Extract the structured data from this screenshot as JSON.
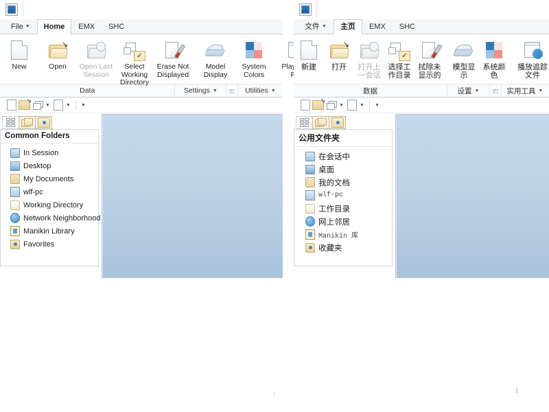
{
  "slide": {
    "page_number": "1"
  },
  "en": {
    "app_icon": "application-icon",
    "tabs": [
      {
        "label": "File",
        "has_caret": true,
        "active": false
      },
      {
        "label": "Home",
        "has_caret": false,
        "active": true
      },
      {
        "label": "EMX",
        "has_caret": false,
        "active": false
      },
      {
        "label": "SHC",
        "has_caret": false,
        "active": false
      }
    ],
    "ribbon": {
      "groups": [
        {
          "caption": "Data",
          "caption_caret": false,
          "dialog_launcher": false,
          "buttons": [
            {
              "label": "New",
              "icon": "new-page-icon",
              "disabled": false
            },
            {
              "label": "Open",
              "icon": "open-folder-icon",
              "disabled": false
            },
            {
              "label": "Open Last Session",
              "icon": "open-last-session-icon",
              "disabled": true
            },
            {
              "label": "Select Working Directory",
              "icon": "select-working-directory-icon",
              "disabled": false
            },
            {
              "label": "Erase Not Displayed",
              "icon": "erase-not-displayed-icon",
              "disabled": false
            }
          ]
        },
        {
          "caption": "Settings",
          "caption_caret": true,
          "dialog_launcher": true,
          "buttons": [
            {
              "label": "Model Display",
              "icon": "model-display-icon",
              "disabled": false
            },
            {
              "label": "System Colors",
              "icon": "system-colors-icon",
              "disabled": false
            }
          ]
        },
        {
          "caption": "Utilities",
          "caption_caret": true,
          "dialog_launcher": false,
          "buttons": [
            {
              "label": "Play Trail File",
              "icon": "play-trail-file-icon",
              "disabled": false
            }
          ]
        }
      ]
    },
    "quick_access": [
      {
        "icon": "new-file-icon",
        "caret": false
      },
      {
        "icon": "open-file-icon",
        "caret": false
      },
      {
        "icon": "window-arrange-icon",
        "caret": true
      },
      {
        "icon": "page-icon",
        "caret": true
      },
      {
        "icon": "overflow-icon",
        "caret": false
      }
    ],
    "tree_tabs": [
      {
        "icon": "grid-dots-icon",
        "selected": false
      },
      {
        "icon": "multi-folder-icon",
        "selected": true
      },
      {
        "icon": "folder-target-icon",
        "selected": true
      }
    ],
    "tree": {
      "header": "Common Folders",
      "items": [
        {
          "label": "In Session",
          "icon": "monitor-icon",
          "mono": false
        },
        {
          "label": "Desktop",
          "icon": "desktop-icon",
          "mono": false
        },
        {
          "label": "My Documents",
          "icon": "my-documents-icon",
          "mono": false
        },
        {
          "label": "wlf-pc",
          "icon": "computer-icon",
          "mono": false
        },
        {
          "label": "Working Directory",
          "icon": "working-directory-icon",
          "mono": false
        },
        {
          "label": "Network Neighborhood",
          "icon": "network-icon",
          "mono": false
        },
        {
          "label": "Manikin Library",
          "icon": "library-icon",
          "mono": false
        },
        {
          "label": "Favorites",
          "icon": "favorites-icon",
          "mono": false
        }
      ]
    }
  },
  "zh": {
    "app_icon": "application-icon",
    "tabs": [
      {
        "label": "文件",
        "has_caret": true,
        "active": false
      },
      {
        "label": "主页",
        "has_caret": false,
        "active": true
      },
      {
        "label": "EMX",
        "has_caret": false,
        "active": false
      },
      {
        "label": "SHC",
        "has_caret": false,
        "active": false
      }
    ],
    "ribbon": {
      "groups": [
        {
          "caption": "数据",
          "caption_caret": false,
          "dialog_launcher": false,
          "buttons": [
            {
              "label": "新建",
              "icon": "new-page-icon",
              "disabled": false
            },
            {
              "label": "打开",
              "icon": "open-folder-icon",
              "disabled": false
            },
            {
              "label": "打开上一会话",
              "icon": "open-last-session-icon",
              "disabled": true
            },
            {
              "label": "选择工作目录",
              "icon": "select-working-directory-icon",
              "disabled": false
            },
            {
              "label": "拭除未显示的",
              "icon": "erase-not-displayed-icon",
              "disabled": false
            }
          ]
        },
        {
          "caption": "设置",
          "caption_caret": true,
          "dialog_launcher": true,
          "buttons": [
            {
              "label": "模型显示",
              "icon": "model-display-icon",
              "disabled": false
            },
            {
              "label": "系统颜色",
              "icon": "system-colors-icon",
              "disabled": false
            }
          ]
        },
        {
          "caption": "实用工具",
          "caption_caret": true,
          "dialog_launcher": false,
          "buttons": [
            {
              "label": "播放追踪文件",
              "icon": "play-trail-file-icon",
              "disabled": false
            }
          ]
        }
      ]
    },
    "quick_access": [
      {
        "icon": "new-file-icon",
        "caret": false
      },
      {
        "icon": "open-file-icon",
        "caret": false
      },
      {
        "icon": "window-arrange-icon",
        "caret": true
      },
      {
        "icon": "page-icon",
        "caret": true
      },
      {
        "icon": "overflow-icon",
        "caret": false
      }
    ],
    "tree_tabs": [
      {
        "icon": "grid-dots-icon",
        "selected": false
      },
      {
        "icon": "multi-folder-icon",
        "selected": true
      },
      {
        "icon": "folder-target-icon",
        "selected": true
      }
    ],
    "tree": {
      "header": "公用文件夹",
      "items": [
        {
          "label": "在会话中",
          "icon": "monitor-icon",
          "mono": false
        },
        {
          "label": "桌面",
          "icon": "desktop-icon",
          "mono": false
        },
        {
          "label": "我的文档",
          "icon": "my-documents-icon",
          "mono": false
        },
        {
          "label": "wlf-pc",
          "icon": "computer-icon",
          "mono": true
        },
        {
          "label": "工作目录",
          "icon": "working-directory-icon",
          "mono": false
        },
        {
          "label": "网上邻居",
          "icon": "network-icon",
          "mono": false
        },
        {
          "label": "Manikin 库",
          "icon": "library-icon",
          "mono": true
        },
        {
          "label": "收藏夹",
          "icon": "favorites-icon",
          "mono": false
        }
      ]
    }
  },
  "colors": {
    "canvas_top": "#c6d8ea",
    "canvas_bottom": "#a9c3dc",
    "tab_active_bg": "#ffffff",
    "tabstrip_bg": "#f4f6f8",
    "border": "#c8ced4",
    "system_colors_swatches": [
      "#2f7cb5",
      "#fbe3e0",
      "#9cc4e4",
      "#ef8f86"
    ]
  }
}
